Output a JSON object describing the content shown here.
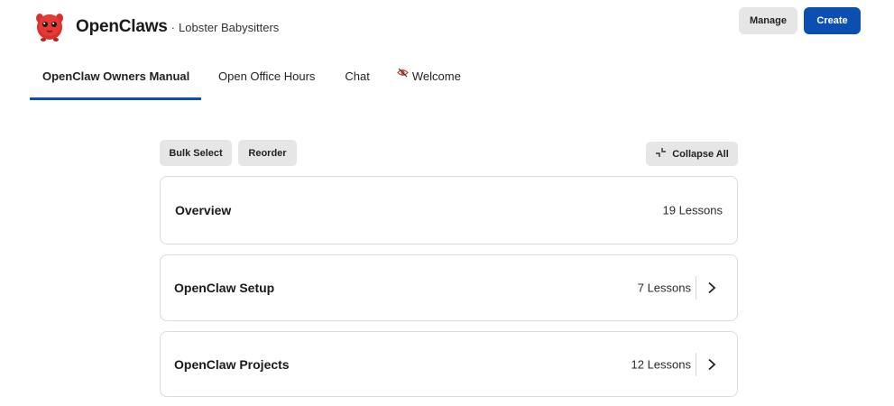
{
  "header": {
    "brand_name": "OpenClaws",
    "separator": "·",
    "subtitle": "Lobster Babysitters",
    "manage_label": "Manage",
    "create_label": "Create"
  },
  "tabs": [
    {
      "label": "OpenClaw Owners Manual",
      "active": true
    },
    {
      "label": "Open Office Hours",
      "active": false
    },
    {
      "label": "Chat",
      "active": false
    },
    {
      "label": "Welcome",
      "active": false,
      "icon": "eye-slash-icon"
    }
  ],
  "toolbar": {
    "bulk_select_label": "Bulk Select",
    "reorder_label": "Reorder",
    "collapse_all_label": "Collapse All"
  },
  "sections": [
    {
      "title": "Overview",
      "lessons": "19 Lessons",
      "expanded": true
    },
    {
      "title": "OpenClaw Setup",
      "lessons": "7 Lessons",
      "expanded": false
    },
    {
      "title": "OpenClaw Projects",
      "lessons": "12 Lessons",
      "expanded": false
    }
  ],
  "colors": {
    "accent": "#0b4fb0",
    "logo_red": "#d9302b",
    "button_gray": "#e6e6e6",
    "border": "#dcdcdc"
  }
}
